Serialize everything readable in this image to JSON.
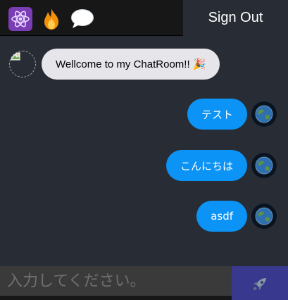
{
  "header": {
    "logos": [
      "react-icon",
      "fire-icon",
      "speech-bubble-icon"
    ],
    "signout_label": "Sign Out"
  },
  "messages": [
    {
      "direction": "received",
      "text": "Wellcome to my ChatRoom!! 🎉",
      "avatar": "broken-image-icon"
    },
    {
      "direction": "sent",
      "text": "テスト",
      "avatar": "earth-avatar-icon"
    },
    {
      "direction": "sent",
      "text": "こんにちは",
      "avatar": "earth-avatar-icon"
    },
    {
      "direction": "sent",
      "text": "asdf",
      "avatar": "earth-avatar-icon"
    }
  ],
  "form": {
    "placeholder": "入力してください。",
    "value": "",
    "send_icon": "rocket-icon"
  },
  "colors": {
    "header_bg": "#181717",
    "chat_bg": "#282c34",
    "sent_bubble": "#0b93f6",
    "received_bubble": "#e5e5ea",
    "send_button": "#38388f"
  }
}
